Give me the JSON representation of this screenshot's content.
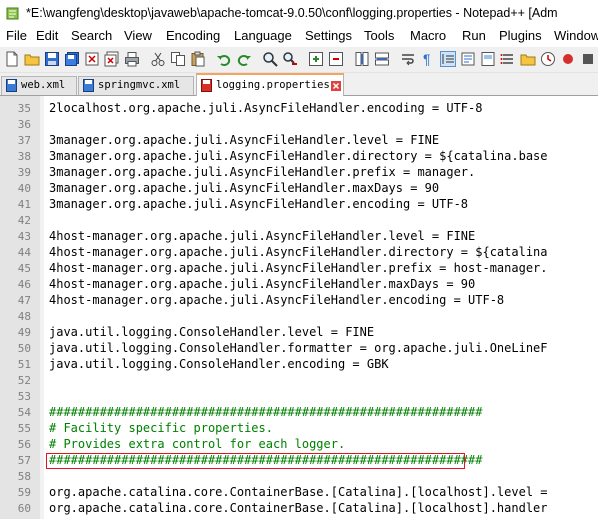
{
  "window": {
    "title": "*E:\\wangfeng\\desktop\\javaweb\\apache-tomcat-9.0.50\\conf\\logging.properties - Notepad++ [Adm"
  },
  "menu": [
    "File",
    "Edit",
    "Search",
    "View",
    "Encoding",
    "Language",
    "Settings",
    "Tools",
    "Macro",
    "Run",
    "Plugins",
    "Window"
  ],
  "tabs": [
    {
      "label": "web.xml",
      "active": false
    },
    {
      "label": "springmvc.xml",
      "active": false
    },
    {
      "label": "logging.properties",
      "active": true
    }
  ],
  "lines": [
    {
      "num": "35",
      "text": "2localhost.org.apache.juli.AsyncFileHandler.encoding = UTF-8"
    },
    {
      "num": "36",
      "text": ""
    },
    {
      "num": "37",
      "text": "3manager.org.apache.juli.AsyncFileHandler.level = FINE"
    },
    {
      "num": "38",
      "text": "3manager.org.apache.juli.AsyncFileHandler.directory = ${catalina.base"
    },
    {
      "num": "39",
      "text": "3manager.org.apache.juli.AsyncFileHandler.prefix = manager."
    },
    {
      "num": "40",
      "text": "3manager.org.apache.juli.AsyncFileHandler.maxDays = 90"
    },
    {
      "num": "41",
      "text": "3manager.org.apache.juli.AsyncFileHandler.encoding = UTF-8"
    },
    {
      "num": "42",
      "text": ""
    },
    {
      "num": "43",
      "text": "4host-manager.org.apache.juli.AsyncFileHandler.level = FINE"
    },
    {
      "num": "44",
      "text": "4host-manager.org.apache.juli.AsyncFileHandler.directory = ${catalina"
    },
    {
      "num": "45",
      "text": "4host-manager.org.apache.juli.AsyncFileHandler.prefix = host-manager."
    },
    {
      "num": "46",
      "text": "4host-manager.org.apache.juli.AsyncFileHandler.maxDays = 90"
    },
    {
      "num": "47",
      "text": "4host-manager.org.apache.juli.AsyncFileHandler.encoding = UTF-8"
    },
    {
      "num": "48",
      "text": ""
    },
    {
      "num": "49",
      "text": "java.util.logging.ConsoleHandler.level = FINE"
    },
    {
      "num": "50",
      "text": "java.util.logging.ConsoleHandler.formatter = org.apache.juli.OneLineF"
    },
    {
      "num": "51",
      "text": "java.util.logging.ConsoleHandler.encoding = GBK"
    },
    {
      "num": "52",
      "text": ""
    },
    {
      "num": "53",
      "text": ""
    },
    {
      "num": "54",
      "text": "############################################################"
    },
    {
      "num": "55",
      "text": "# Facility specific properties."
    },
    {
      "num": "56",
      "text": "# Provides extra control for each logger."
    },
    {
      "num": "57",
      "text": "############################################################"
    },
    {
      "num": "58",
      "text": ""
    },
    {
      "num": "59",
      "text": "org.apache.catalina.core.ContainerBase.[Catalina].[localhost].level ="
    },
    {
      "num": "60",
      "text": "org.apache.catalina.core.ContainerBase.[Catalina].[localhost].handler"
    }
  ]
}
